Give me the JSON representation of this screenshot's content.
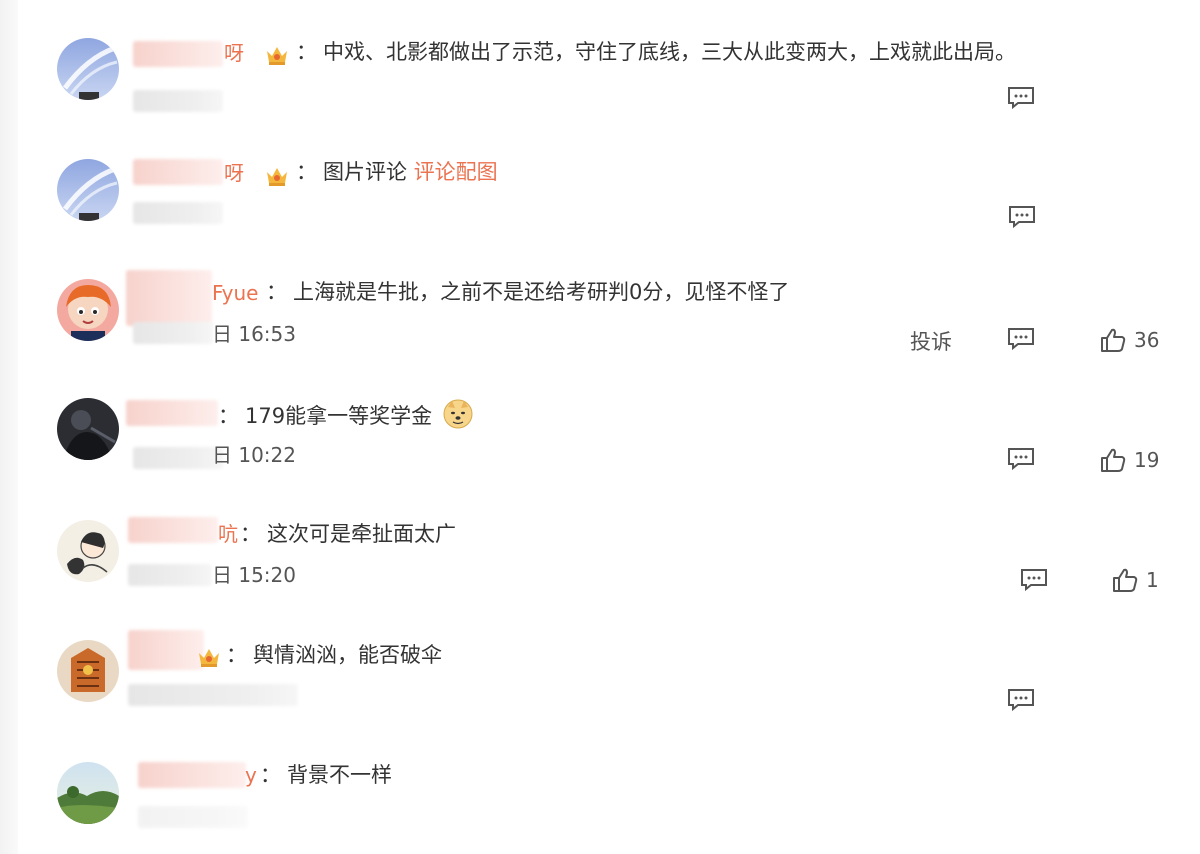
{
  "comments": [
    {
      "name_tail": "呀",
      "crown": true,
      "text": "中戏、北影都做出了示范，守住了底线，三大从此变两大，上戏就此出局。",
      "link": "",
      "time": "",
      "report": "",
      "likes": ""
    },
    {
      "name_tail": "呀",
      "crown": true,
      "text": "图片评论",
      "link": "评论配图",
      "time": "",
      "report": "",
      "likes": ""
    },
    {
      "name_tail": "Fyue",
      "crown": false,
      "text": "上海就是牛批，之前不是还给考研判0分，见怪不怪了",
      "link": "",
      "time": "日 16:53",
      "report": "投诉",
      "likes": "36"
    },
    {
      "name_tail": "",
      "crown": false,
      "text": "179能拿一等奖学金",
      "link": "",
      "time": "日 10:22",
      "report": "",
      "likes": "19",
      "emoji": "doge-emoji"
    },
    {
      "name_tail": "吭",
      "crown": false,
      "text": "这次可是牵扯面太广",
      "link": "",
      "time": "日 15:20",
      "report": "",
      "likes": "1"
    },
    {
      "name_tail": "",
      "crown": true,
      "text": "舆情汹汹，能否破伞",
      "link": "",
      "time": "",
      "report": "",
      "likes": ""
    },
    {
      "name_tail": "y",
      "crown": false,
      "text": "背景不一样",
      "link": "",
      "time": "",
      "report": "",
      "likes": ""
    }
  ],
  "colon": "：",
  "colors": {
    "link": "#eb7350",
    "text": "#333333",
    "meta": "#555555"
  },
  "icons": {
    "reply": "comment-icon",
    "like": "thumb-up-icon",
    "badge": "crown-badge-icon"
  }
}
